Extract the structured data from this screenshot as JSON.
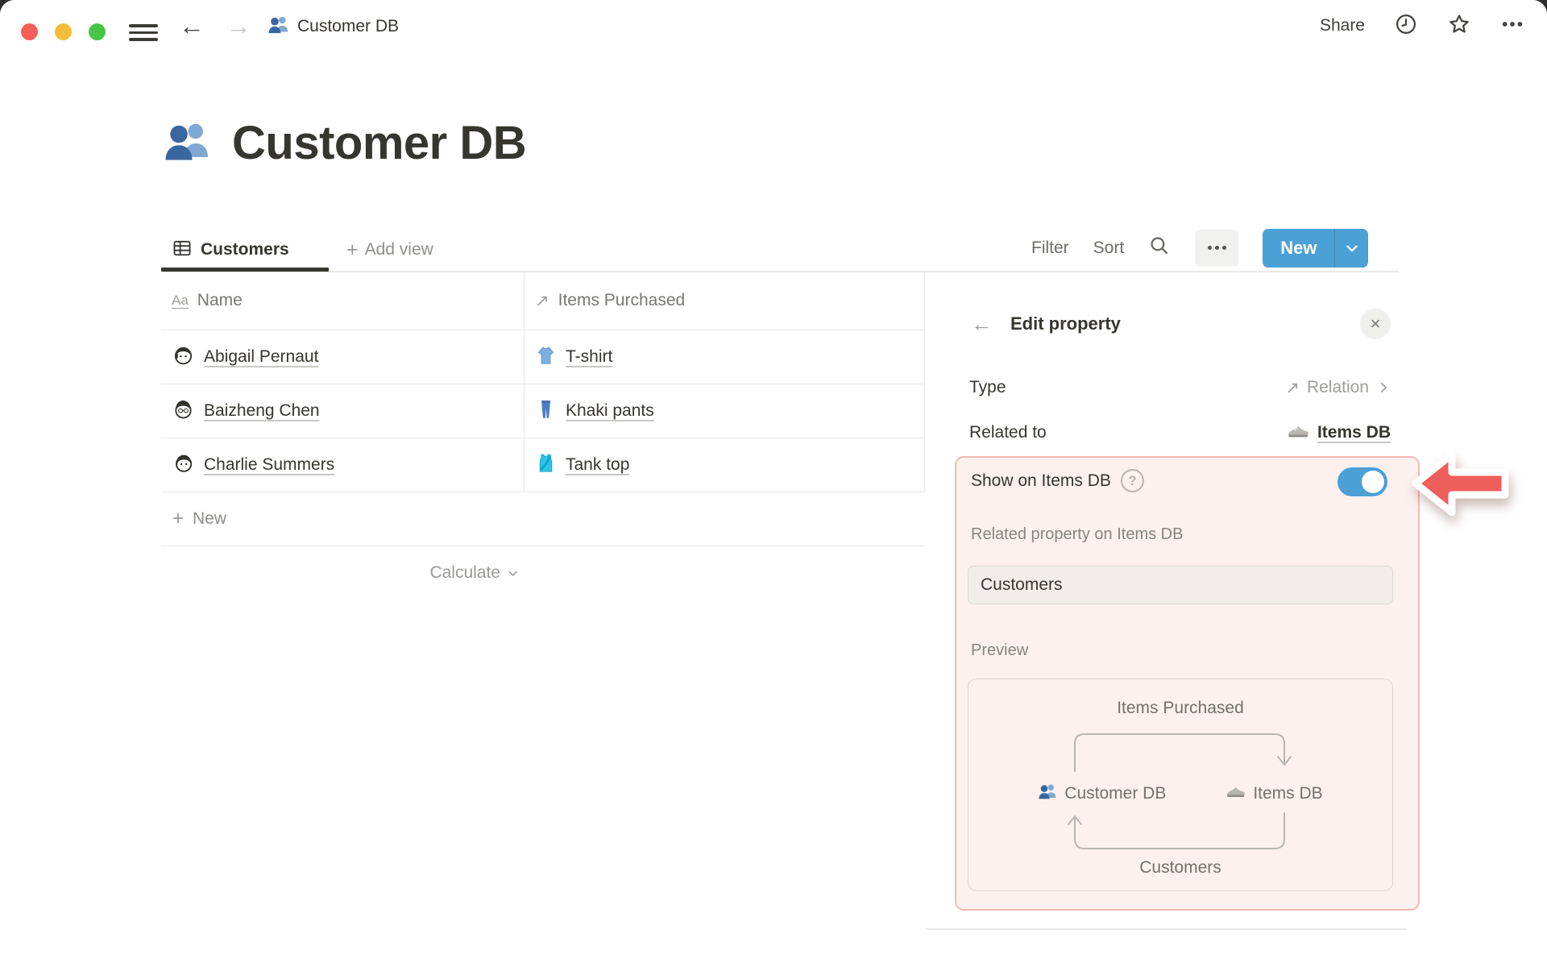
{
  "colors": {
    "accent_blue": "#4ba0d6",
    "highlight_bg": "#fcf1ef",
    "highlight_border": "#f3bab4",
    "annotation_arrow_red": "#ee5e5b",
    "text_dark": "#37352f",
    "text_gray": "#787774"
  },
  "topbar": {
    "breadcrumb": "Customer DB",
    "share_label": "Share"
  },
  "page": {
    "title": "Customer DB"
  },
  "toolbar": {
    "view_tab": "Customers",
    "add_view": "Add view",
    "filter": "Filter",
    "sort": "Sort",
    "new_button": "New"
  },
  "table": {
    "columns": [
      {
        "label": "Name",
        "icon": "text-property-icon"
      },
      {
        "label": "Items Purchased",
        "icon": "relation-property-icon"
      }
    ],
    "rows": [
      {
        "name": "Abigail Pernaut",
        "item": "T-shirt"
      },
      {
        "name": "Baizheng Chen",
        "item": "Khaki pants"
      },
      {
        "name": "Charlie Summers",
        "item": "Tank top"
      }
    ],
    "new_row": "New",
    "calculate": "Calculate"
  },
  "panel": {
    "title": "Edit property",
    "type_label": "Type",
    "type_value": "Relation",
    "related_label": "Related to",
    "related_value": "Items DB",
    "show_on_label": "Show on Items DB",
    "show_on_enabled": true,
    "related_property_label": "Related property on Items DB",
    "related_property_value": "Customers",
    "preview_label": "Preview",
    "preview": {
      "top_relation": "Items Purchased",
      "left_db": "Customer DB",
      "right_db": "Items DB",
      "bottom_relation": "Customers"
    }
  }
}
